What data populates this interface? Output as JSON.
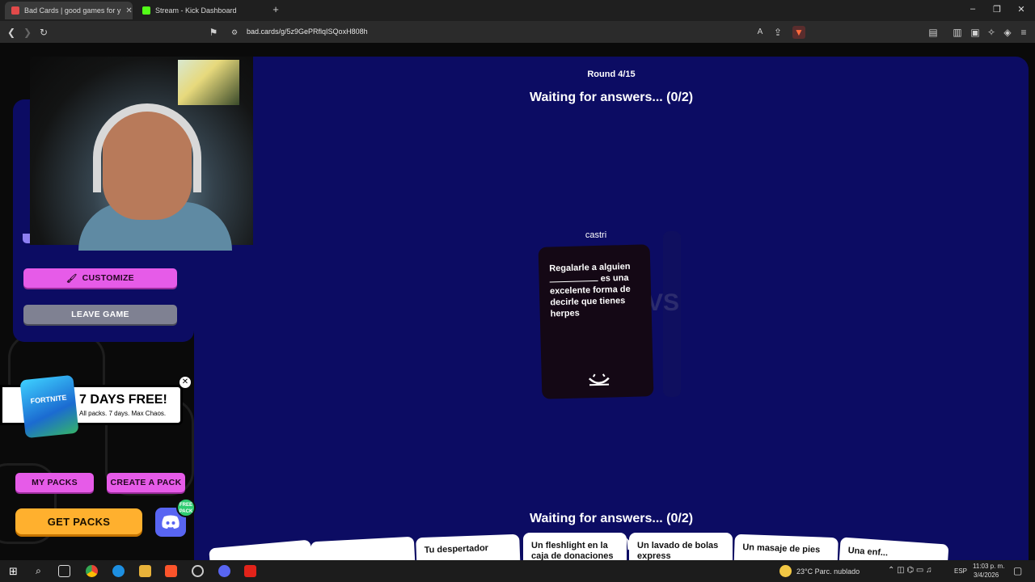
{
  "browser": {
    "tabs": [
      {
        "title": "Bad Cards | good games for y",
        "active": true
      },
      {
        "title": "Stream - Kick Dashboard",
        "active": false
      }
    ],
    "url": "bad.cards/g/5z9GePRflqISQoxH808h"
  },
  "game": {
    "round": "Round 4/15",
    "waiting_top": "Waiting for answers... (0/2)",
    "waiting_bottom": "Waiting for answers... (0/2)",
    "player_name": "castri",
    "black_card": {
      "before": "Regalarle a alguien",
      "after": "es una excelente forma de decirle que tienes herpes"
    },
    "hand_cards": [
      "",
      "",
      "Tu despertador",
      "Un fleshlight en la caja de donaciones",
      "Un lavado de bolas express",
      "Un masaje de pies",
      "Una enf..."
    ]
  },
  "sidebar": {
    "customize_label": "CUSTOMIZE",
    "leave_label": "LEAVE GAME"
  },
  "promo": {
    "title": "7 DAYS FREE!",
    "subtitle": "All packs. 7 days. Max Chaos.",
    "image_label": "FORTNITE"
  },
  "footer_buttons": {
    "my_packs": "MY PACKS",
    "create_pack": "CREATE A PACK",
    "get_packs": "GET PACKS",
    "discord_badge": "FREE PACK"
  },
  "taskbar": {
    "weather": "23°C  Parc. nublado",
    "language": "ESP",
    "time": "11:03 p. m.",
    "date": "3/4/2026"
  },
  "colors": {
    "panel": "#0c0c63",
    "pink": "#e65be8",
    "orange": "#ffb02e",
    "discord": "#5865f2"
  }
}
